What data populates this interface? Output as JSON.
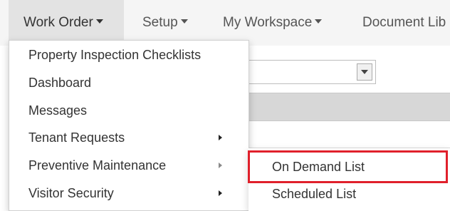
{
  "nav": {
    "items": [
      {
        "label": "Work Order"
      },
      {
        "label": "Setup"
      },
      {
        "label": "My Workspace"
      },
      {
        "label": "Document Lib"
      }
    ]
  },
  "work_order_menu": {
    "items": [
      {
        "label": "Property Inspection Checklists"
      },
      {
        "label": "Dashboard"
      },
      {
        "label": "Messages"
      },
      {
        "label": "Tenant Requests"
      },
      {
        "label": "Preventive Maintenance"
      },
      {
        "label": "Visitor Security"
      }
    ]
  },
  "preventive_maintenance_submenu": {
    "items": [
      {
        "label": "On Demand List"
      },
      {
        "label": "Scheduled List"
      }
    ]
  },
  "colors": {
    "highlight_border": "#e0202b",
    "navbar_bg": "#f5f5f5",
    "active_nav_bg": "#e3e3e3"
  }
}
